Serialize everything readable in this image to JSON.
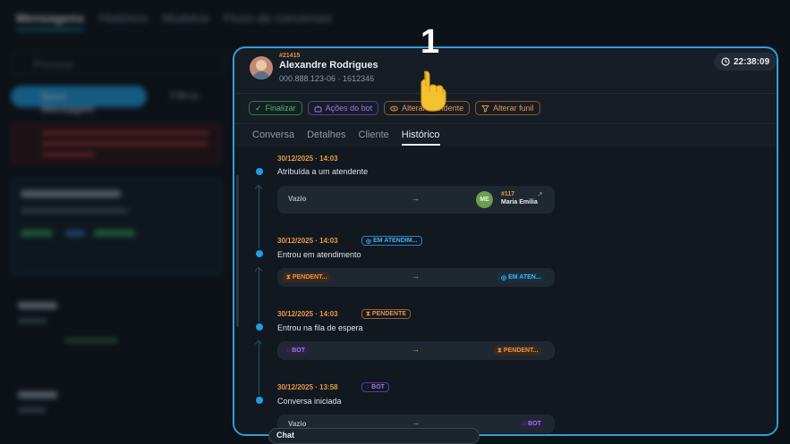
{
  "background": {
    "tabs": [
      "Mensagens",
      "Histórico",
      "Modelos",
      "Fluxo de conversas"
    ],
    "search_placeholder": "Procurar",
    "new_message_label": "Novo Mensagem",
    "filter_label": "Filtros"
  },
  "panel": {
    "ticket": "#21415",
    "contact_name": "Alexandre Rodrigues",
    "contact_phone": "000.888.123-06 · 1612346",
    "timer": "22:38:09",
    "actions": {
      "finalize": "Finalizar",
      "bot_actions": "Ações do bot",
      "change_agent": "Alterar atendente",
      "change_funnel": "Alterar funil"
    },
    "tabs": [
      "Conversa",
      "Detalhes",
      "Cliente",
      "Histórico"
    ],
    "active_tab": "Histórico",
    "events": [
      {
        "date": "30/12/2025 · 14:03",
        "title": "Atribuída a um atendente",
        "from": "Vazio",
        "to_initials": "ME",
        "to_id": "#117",
        "to_name": "Maria Emilia"
      },
      {
        "date": "30/12/2025 · 14:03",
        "badge": "EM ATENDIM...",
        "title": "Entrou em atendimento",
        "from_chip": "PENDENT...",
        "to_chip": "EM ATEN..."
      },
      {
        "date": "30/12/2025 · 14:03",
        "badge": "PENDENTE",
        "title": "Entrou na fila de espera",
        "from_chip": "BOT",
        "to_chip": "PENDENT..."
      },
      {
        "date": "30/12/2025 · 13:58",
        "badge": "BOT",
        "title": "Conversa iniciada",
        "from": "Vazio",
        "to_chip": "BOT"
      }
    ],
    "chat_label": "Chat"
  },
  "annotation": {
    "step_number": "1"
  },
  "colors": {
    "accent_blue": "#2e9fdc",
    "orange": "#e8944a",
    "green": "#46c06f",
    "purple": "#9b78ec"
  }
}
